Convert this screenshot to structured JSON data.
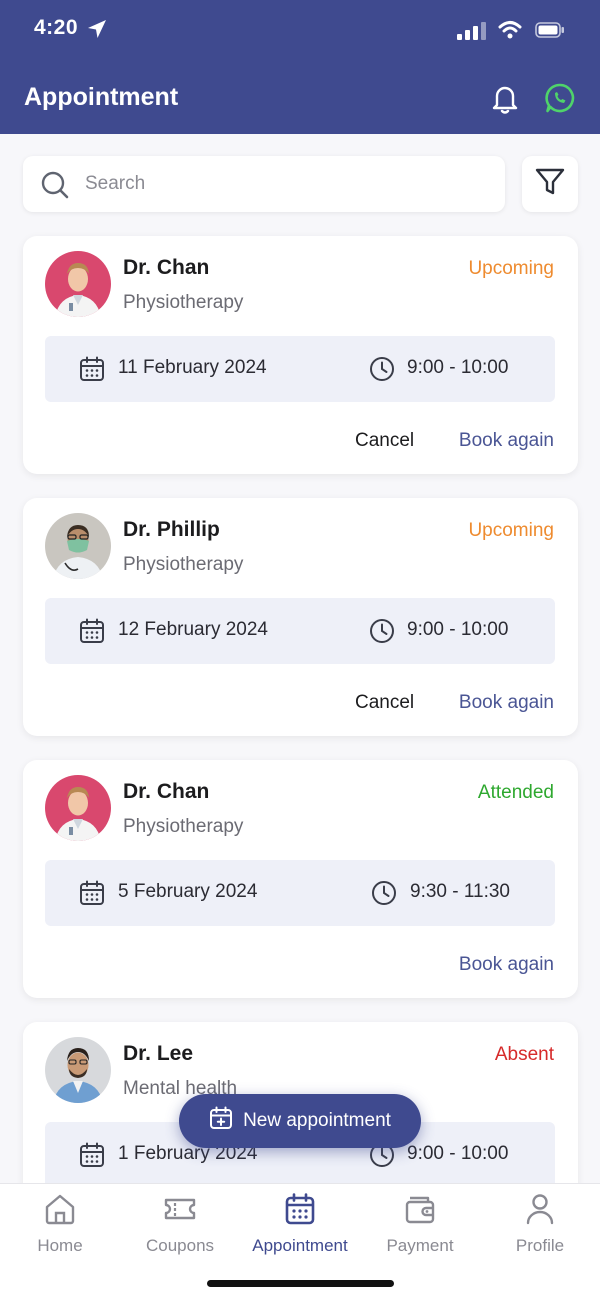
{
  "status_bar": {
    "time": "4:20"
  },
  "header": {
    "title": "Appointment"
  },
  "search": {
    "placeholder": "Search"
  },
  "appointments": [
    {
      "doctor": "Dr. Chan",
      "specialty": "Physiotherapy",
      "status": "Upcoming",
      "date": "11 February 2024",
      "time": "9:00 - 10:00",
      "cancel_label": "Cancel",
      "book_label": "Book again"
    },
    {
      "doctor": "Dr. Phillip",
      "specialty": "Physiotherapy",
      "status": "Upcoming",
      "date": "12 February 2024",
      "time": "9:00 - 10:00",
      "cancel_label": "Cancel",
      "book_label": "Book again"
    },
    {
      "doctor": "Dr. Chan",
      "specialty": "Physiotherapy",
      "status": "Attended",
      "date": "5 February 2024",
      "time": "9:30 - 11:30",
      "book_label": "Book again"
    },
    {
      "doctor": "Dr. Lee",
      "specialty": "Mental health",
      "status": "Absent",
      "date": "1 February 2024",
      "time": "9:00 - 10:00"
    }
  ],
  "fab": {
    "label": "New appointment"
  },
  "nav": {
    "items": [
      {
        "label": "Home",
        "icon": "home-icon"
      },
      {
        "label": "Coupons",
        "icon": "coupon-icon"
      },
      {
        "label": "Appointment",
        "icon": "calendar-icon",
        "active": true
      },
      {
        "label": "Payment",
        "icon": "wallet-icon"
      },
      {
        "label": "Profile",
        "icon": "user-icon"
      }
    ]
  },
  "colors": {
    "primary": "#3f4a8f",
    "upcoming": "#ee8b2f",
    "attended": "#2ea82f",
    "absent": "#d62a2a",
    "datetime_bg": "#eef0f8"
  }
}
